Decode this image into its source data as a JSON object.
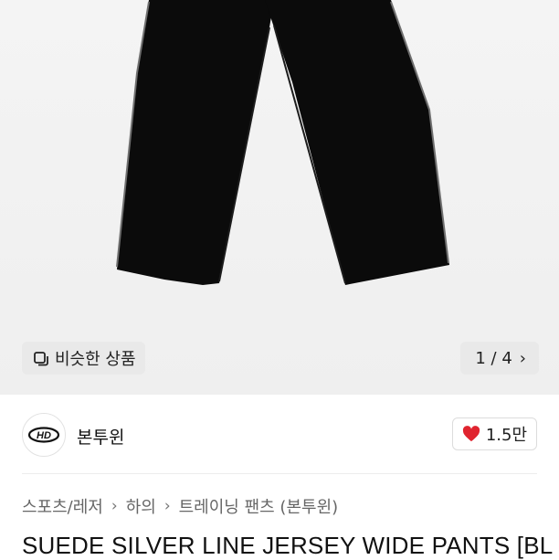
{
  "product_image": {
    "similar_button_label": "비슷한 상품",
    "similar_icon": "similar-items-icon",
    "pager_text": "1 / 4",
    "pager_icon": "chevron-right-icon"
  },
  "shop": {
    "logo_text": "HD",
    "name": "본투윈",
    "like_icon": "heart-icon",
    "like_count": "1.5만",
    "heart_color": "#e0242f"
  },
  "breadcrumb": {
    "items": [
      "스포츠/레저",
      "하의",
      "트레이닝 팬츠 (본투윈)"
    ],
    "separator_icon": "chevron-right-icon"
  },
  "product": {
    "title": "SUEDE SILVER LINE JERSEY WIDE PANTS [BL"
  }
}
